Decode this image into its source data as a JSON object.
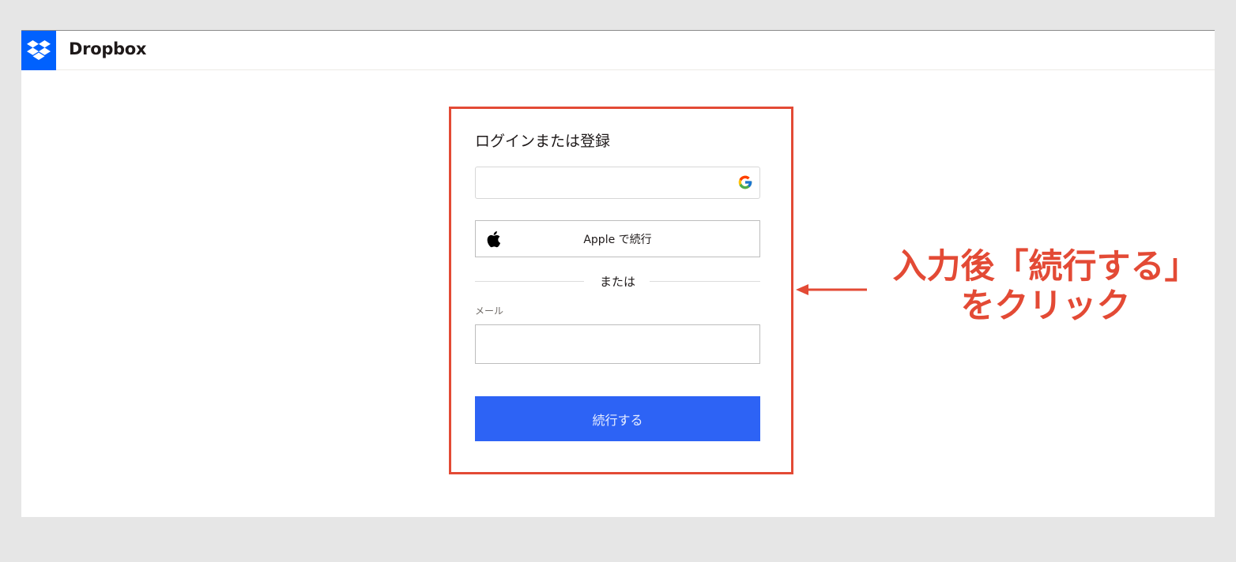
{
  "header": {
    "brand_name": "Dropbox",
    "logo_icon": "dropbox-logo-icon",
    "brand_color": "#0061fe"
  },
  "login_card": {
    "title": "ログインまたは登録",
    "google_button": {
      "icon": "google-icon",
      "label": ""
    },
    "apple_button": {
      "icon": "apple-icon",
      "label": "Apple で続行"
    },
    "divider_text": "または",
    "email_field": {
      "label": "メール",
      "value": ""
    },
    "continue_button": {
      "label": "続行する",
      "color": "#2d63f5"
    },
    "highlight_color": "#e34a35"
  },
  "annotation": {
    "line1": "入力後「続行する」",
    "line2": "をクリック",
    "arrow_icon": "arrow-left-icon",
    "color": "#e34a35"
  }
}
